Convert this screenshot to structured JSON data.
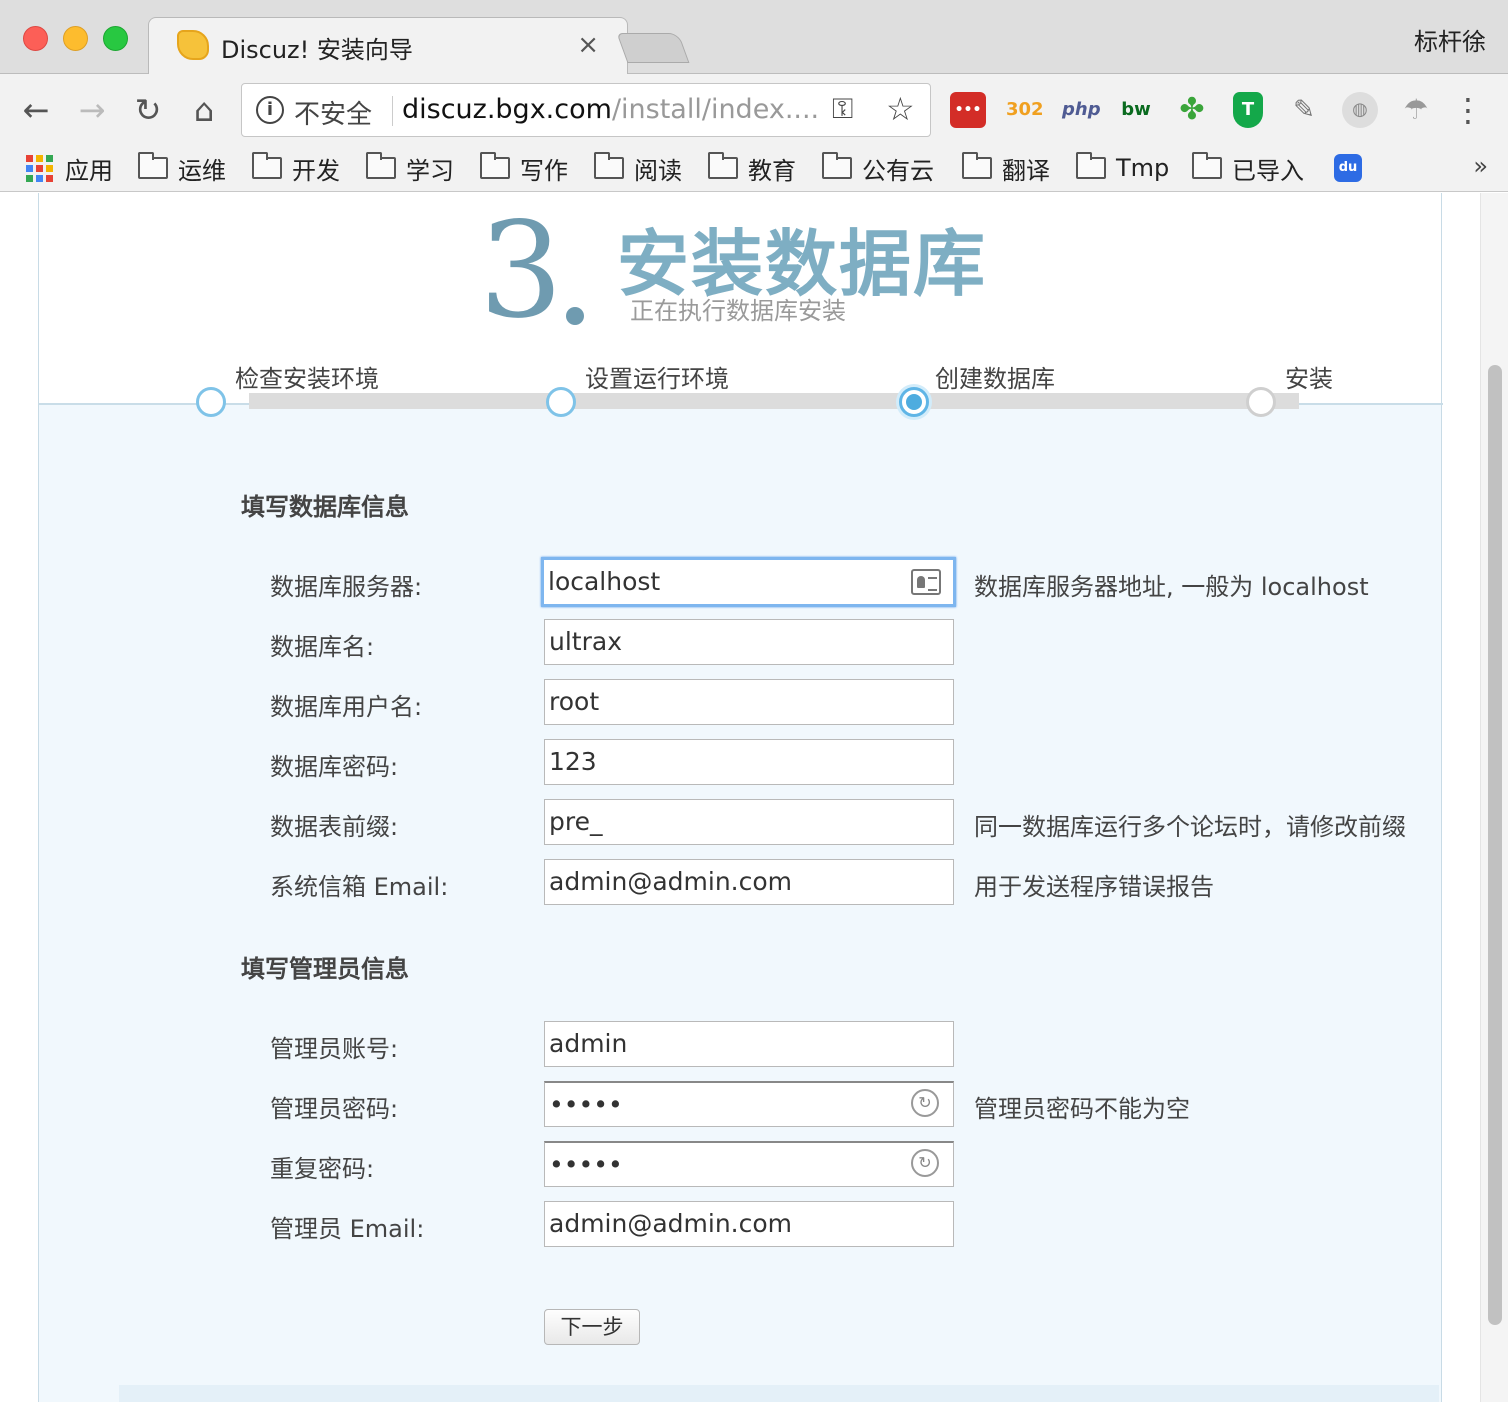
{
  "browser": {
    "tab_title": "Discuz! 安装向导",
    "tab_close": "×",
    "profile_name": "标杆徐",
    "security_label": "不安全",
    "url_host": "discuz.bgx.com",
    "url_path": "/install/index....",
    "extensions": [
      {
        "name": "lastpass",
        "text": "•••",
        "color": "#d32d27"
      },
      {
        "name": "302",
        "text": "302",
        "color": "#f0a020"
      },
      {
        "name": "php",
        "text": "php",
        "color": "#4f5b93"
      },
      {
        "name": "bw",
        "text": "bw",
        "color": "#0a6b1f"
      },
      {
        "name": "clover",
        "text": "✤",
        "color": "#3aa53a"
      },
      {
        "name": "shield",
        "text": "T",
        "color": "#14a84a"
      }
    ],
    "bookmarks": [
      {
        "label": "应用",
        "type": "apps"
      },
      {
        "label": "运维",
        "type": "folder"
      },
      {
        "label": "开发",
        "type": "folder"
      },
      {
        "label": "学习",
        "type": "folder"
      },
      {
        "label": "写作",
        "type": "folder"
      },
      {
        "label": "阅读",
        "type": "folder"
      },
      {
        "label": "教育",
        "type": "folder"
      },
      {
        "label": "公有云",
        "type": "folder"
      },
      {
        "label": "翻译",
        "type": "folder"
      },
      {
        "label": "Tmp",
        "type": "folder"
      },
      {
        "label": "已导入",
        "type": "folder"
      }
    ],
    "more": "»"
  },
  "installer": {
    "step_number": "3",
    "step_title": "安装数据库",
    "step_subtitle": "正在执行数据库安装",
    "steps": [
      {
        "label": "检查安装环境",
        "state": "done"
      },
      {
        "label": "设置运行环境",
        "state": "done"
      },
      {
        "label": "创建数据库",
        "state": "current"
      },
      {
        "label": "安装",
        "state": "todo"
      }
    ],
    "db_section_title": "填写数据库信息",
    "db_fields": [
      {
        "label": "数据库服务器:",
        "value": "localhost",
        "hint": "数据库服务器地址, 一般为 localhost"
      },
      {
        "label": "数据库名:",
        "value": "ultrax",
        "hint": ""
      },
      {
        "label": "数据库用户名:",
        "value": "root",
        "hint": ""
      },
      {
        "label": "数据库密码:",
        "value": "123",
        "hint": ""
      },
      {
        "label": "数据表前缀:",
        "value": "pre_",
        "hint": "同一数据库运行多个论坛时，请修改前缀"
      },
      {
        "label": "系统信箱 Email:",
        "value": "admin@admin.com",
        "hint": "用于发送程序错误报告"
      }
    ],
    "admin_section_title": "填写管理员信息",
    "admin_fields": [
      {
        "label": "管理员账号:",
        "value": "admin",
        "hint": ""
      },
      {
        "label": "管理员密码:",
        "value": "•••••",
        "hint": "管理员密码不能为空"
      },
      {
        "label": "重复密码:",
        "value": "•••••",
        "hint": ""
      },
      {
        "label": "管理员 Email:",
        "value": "admin@admin.com",
        "hint": ""
      }
    ],
    "next_button": "下一步"
  }
}
